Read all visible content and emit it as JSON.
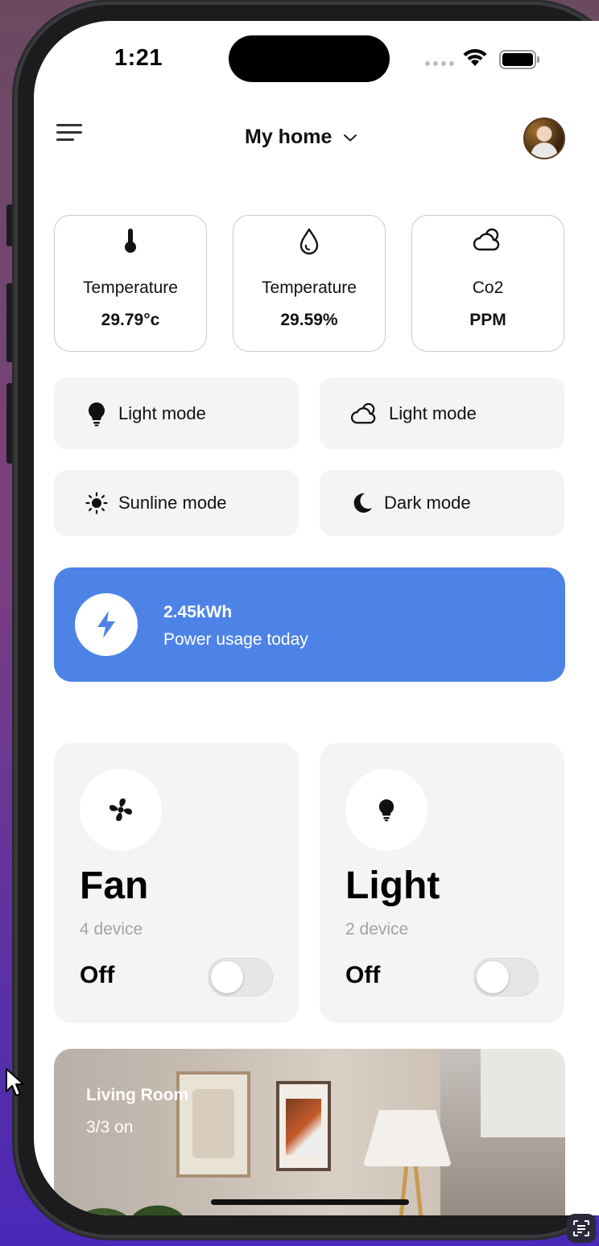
{
  "status_bar": {
    "time": "1:21"
  },
  "header": {
    "title": "My home"
  },
  "sensors": [
    {
      "icon": "thermometer-icon",
      "label": "Temperature",
      "value": "29.79°c"
    },
    {
      "icon": "water-drop-icon",
      "label": "Temperature",
      "value": "29.59%"
    },
    {
      "icon": "cloud-sun-icon",
      "label": "Co2",
      "value": "PPM"
    }
  ],
  "modes": [
    {
      "icon": "bulb-icon",
      "label": "Light mode"
    },
    {
      "icon": "cloud-sun-icon",
      "label": "Light mode"
    },
    {
      "icon": "sun-icon",
      "label": "Sunline mode"
    },
    {
      "icon": "moon-icon",
      "label": "Dark mode"
    }
  ],
  "power": {
    "value": "2.45kWh",
    "label": "Power usage today",
    "color": "#4d83e6"
  },
  "devices": [
    {
      "icon": "fan-icon",
      "name": "Fan",
      "count": "4 device",
      "state": "Off",
      "on": false
    },
    {
      "icon": "bulb-icon",
      "name": "Light",
      "count": "2 device",
      "state": "Off",
      "on": false
    }
  ],
  "room": {
    "name": "Living Room",
    "status": "3/3 on"
  }
}
